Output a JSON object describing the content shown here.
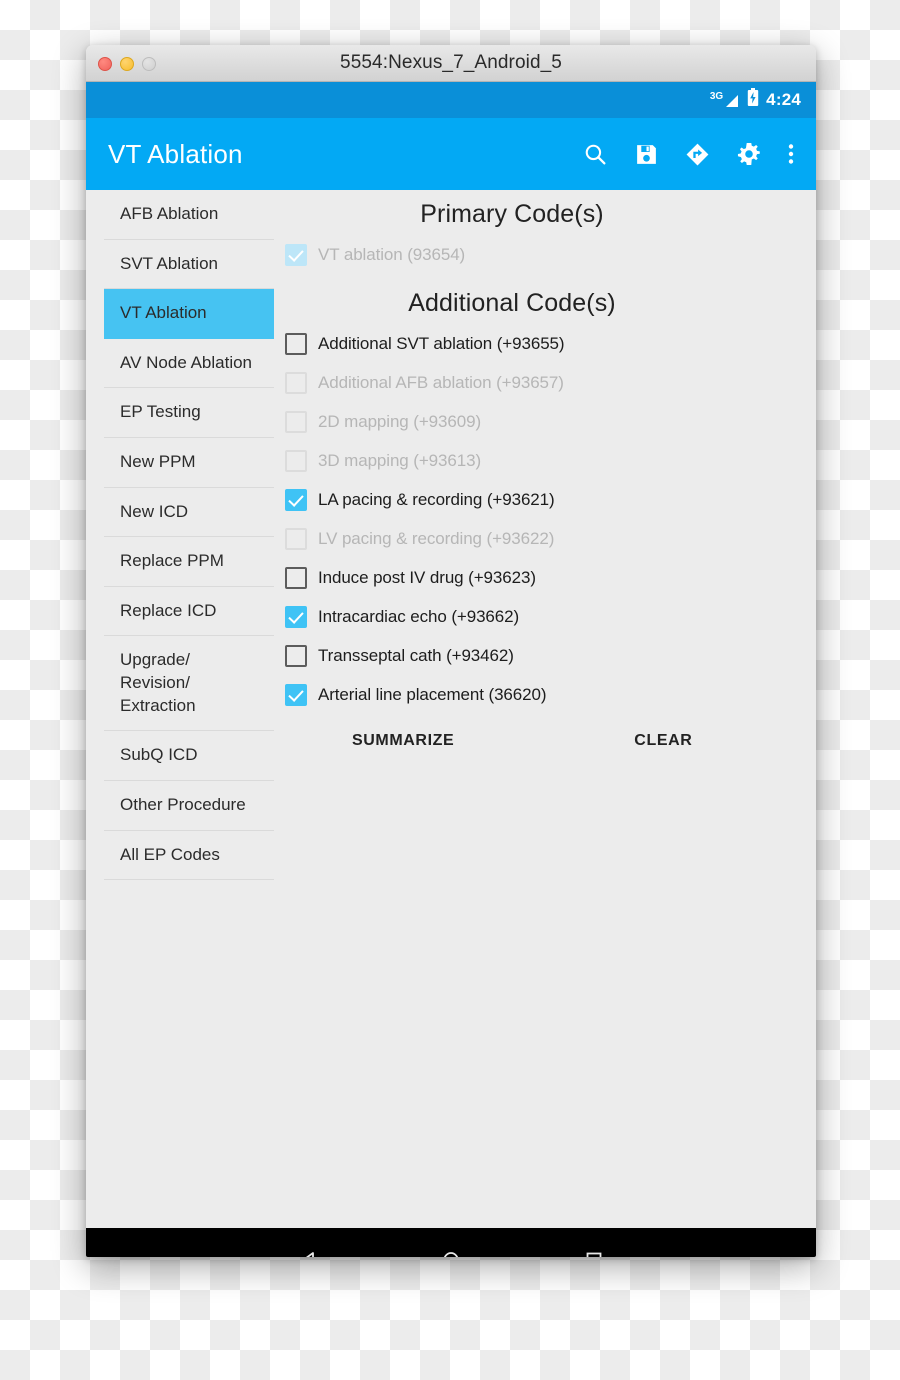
{
  "window": {
    "title": "5554:Nexus_7_Android_5",
    "traffic_lights": [
      "close",
      "minimize",
      "zoom"
    ]
  },
  "status_bar": {
    "network_label": "3G",
    "battery_icon": "battery-charging-icon",
    "time": "4:24"
  },
  "app_bar": {
    "title": "VT Ablation",
    "actions": [
      {
        "name": "search-icon",
        "label": "Search"
      },
      {
        "name": "save-icon",
        "label": "Save"
      },
      {
        "name": "directions-icon",
        "label": "Directions"
      },
      {
        "name": "settings-gear-icon",
        "label": "Settings"
      },
      {
        "name": "overflow-menu-icon",
        "label": "More options"
      }
    ]
  },
  "sidebar": {
    "items": [
      {
        "label": "AFB Ablation",
        "selected": false
      },
      {
        "label": "SVT Ablation",
        "selected": false
      },
      {
        "label": "VT Ablation",
        "selected": true
      },
      {
        "label": "AV Node Ablation",
        "selected": false
      },
      {
        "label": "EP Testing",
        "selected": false
      },
      {
        "label": "New PPM",
        "selected": false
      },
      {
        "label": "New ICD",
        "selected": false
      },
      {
        "label": "Replace PPM",
        "selected": false
      },
      {
        "label": "Replace ICD",
        "selected": false
      },
      {
        "label": "Upgrade/ Revision/ Extraction",
        "selected": false
      },
      {
        "label": "SubQ ICD",
        "selected": false
      },
      {
        "label": "Other Procedure",
        "selected": false
      },
      {
        "label": "All EP Codes",
        "selected": false
      }
    ]
  },
  "content": {
    "primary_title": "Primary Code(s)",
    "primary_codes": [
      {
        "label": "VT ablation (93654)",
        "checked": true,
        "enabled": false
      }
    ],
    "additional_title": "Additional Code(s)",
    "additional_codes": [
      {
        "label": "Additional SVT ablation (+93655)",
        "checked": false,
        "enabled": true
      },
      {
        "label": "Additional AFB ablation (+93657)",
        "checked": false,
        "enabled": false
      },
      {
        "label": "2D mapping (+93609)",
        "checked": false,
        "enabled": false
      },
      {
        "label": "3D mapping (+93613)",
        "checked": false,
        "enabled": false
      },
      {
        "label": "LA pacing & recording (+93621)",
        "checked": true,
        "enabled": true
      },
      {
        "label": "LV pacing & recording (+93622)",
        "checked": false,
        "enabled": false
      },
      {
        "label": "Induce post IV drug (+93623)",
        "checked": false,
        "enabled": true
      },
      {
        "label": "Intracardiac echo (+93662)",
        "checked": true,
        "enabled": true
      },
      {
        "label": "Transseptal cath (+93462)",
        "checked": false,
        "enabled": true
      },
      {
        "label": "Arterial line placement (36620)",
        "checked": true,
        "enabled": true
      }
    ],
    "summarize_label": "SUMMARIZE",
    "clear_label": "CLEAR"
  },
  "nav_bar": {
    "buttons": [
      {
        "name": "back-button",
        "icon": "triangle-left-icon"
      },
      {
        "name": "home-button",
        "icon": "circle-icon"
      },
      {
        "name": "recents-button",
        "icon": "square-icon"
      }
    ]
  },
  "colors": {
    "app_bar": "#03A9F4",
    "status_bar": "#0A8FD8",
    "accent": "#3FC3F5",
    "selected_nav": "#46C3F2",
    "background": "#ECECEC"
  }
}
